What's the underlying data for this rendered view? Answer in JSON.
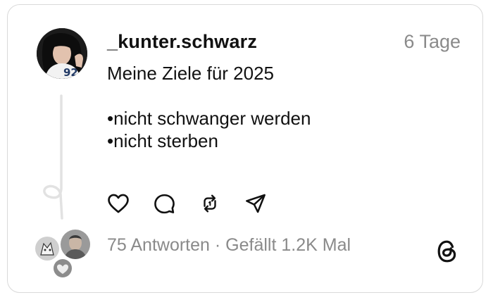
{
  "post": {
    "username": "_kunter.schwarz",
    "timestamp": "6 Tage",
    "lines": [
      "Meine Ziele für 2025",
      "",
      "•nicht schwanger werden",
      "•nicht sterben"
    ]
  },
  "stats": {
    "replies": "75 Antworten",
    "separator": "·",
    "likes": "Gefällt 1.2K Mal"
  },
  "icons": {
    "like": "heart-icon",
    "reply": "comment-icon",
    "repost": "repost-icon",
    "share": "send-icon",
    "brand": "threads-logo-icon"
  },
  "colors": {
    "text": "#111111",
    "muted": "#8a8a8a",
    "border": "#d9d9d9",
    "thread_line": "#e2e2e2"
  }
}
